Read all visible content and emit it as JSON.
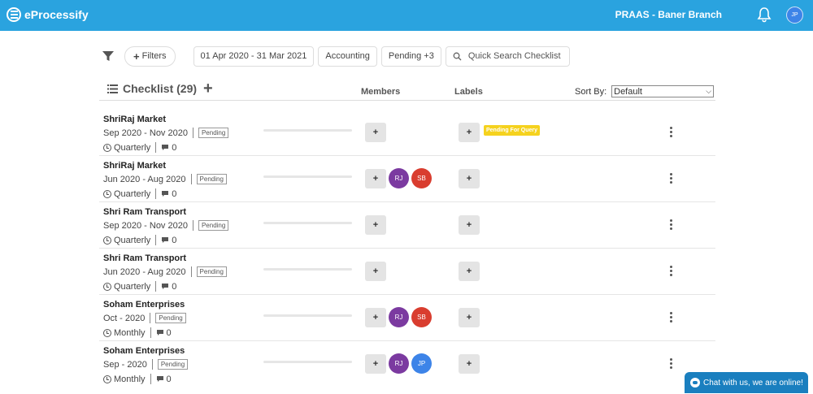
{
  "app": {
    "brand": "eProcessify",
    "branch": "PRAAS - Baner Branch",
    "user_initials": "JP"
  },
  "filters": {
    "filters_label": "Filters",
    "date_range": "01 Apr 2020 - 31 Mar 2021",
    "department": "Accounting",
    "status": "Pending +3",
    "search_placeholder": "Quick Search Checklist"
  },
  "header": {
    "title": "Checklist (29)",
    "members": "Members",
    "labels": "Labels",
    "sort_by_label": "Sort By:",
    "sort_value": "Default"
  },
  "rows": [
    {
      "name": "ShriRaj Market",
      "period": "Sep 2020 - Nov 2020",
      "status": "Pending",
      "frequency": "Quarterly",
      "comments": "0",
      "progress": 0,
      "members": [],
      "label": "Pending For Query"
    },
    {
      "name": "ShriRaj Market",
      "period": "Jun 2020 - Aug 2020",
      "status": "Pending",
      "frequency": "Quarterly",
      "comments": "0",
      "progress": 0,
      "members": [
        {
          "initials": "RJ",
          "color": "#7b3aa0"
        },
        {
          "initials": "SB",
          "color": "#d93d2f"
        }
      ],
      "label": ""
    },
    {
      "name": "Shri Ram Transport",
      "period": "Sep 2020 - Nov 2020",
      "status": "Pending",
      "frequency": "Quarterly",
      "comments": "0",
      "progress": 0,
      "members": [],
      "label": ""
    },
    {
      "name": "Shri Ram Transport",
      "period": "Jun 2020 - Aug 2020",
      "status": "Pending",
      "frequency": "Quarterly",
      "comments": "0",
      "progress": 0,
      "members": [],
      "label": ""
    },
    {
      "name": "Soham Enterprises",
      "period": "Oct - 2020",
      "status": "Pending",
      "frequency": "Monthly",
      "comments": "0",
      "progress": 0,
      "members": [
        {
          "initials": "RJ",
          "color": "#7b3aa0"
        },
        {
          "initials": "SB",
          "color": "#d93d2f"
        }
      ],
      "label": ""
    },
    {
      "name": "Soham Enterprises",
      "period": "Sep - 2020",
      "status": "Pending",
      "frequency": "Monthly",
      "comments": "0",
      "progress": 0,
      "members": [
        {
          "initials": "RJ",
          "color": "#7b3aa0"
        },
        {
          "initials": "JP",
          "color": "#3d84e8"
        }
      ],
      "label": ""
    }
  ],
  "add_symbol": "+",
  "chat": {
    "label": "Chat with us, we are online!"
  },
  "colors": {
    "topbar": "#2aa3df",
    "label_badge": "#f5d21e",
    "chat": "#1a7fbf"
  }
}
